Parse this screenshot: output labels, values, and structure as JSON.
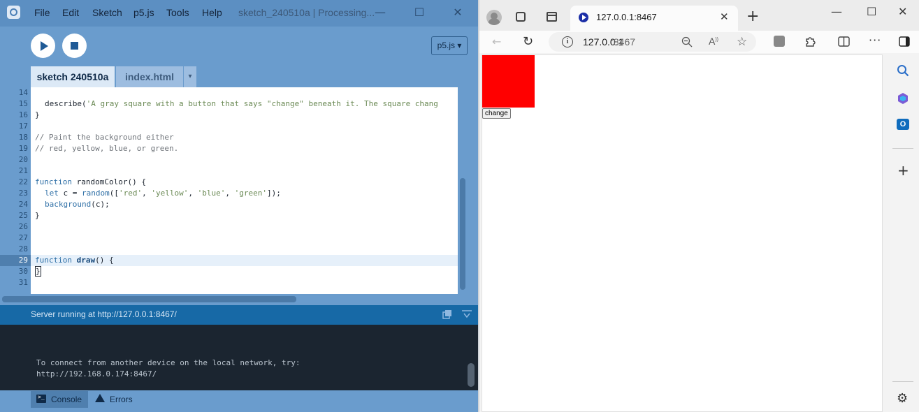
{
  "ide": {
    "menu": [
      "File",
      "Edit",
      "Sketch",
      "p5.js",
      "Tools",
      "Help"
    ],
    "window_title": "sketch_240510a | Processing...",
    "mode": "p5.js ▾",
    "tabs": [
      {
        "label": "sketch 240510a",
        "active": true
      },
      {
        "label": "index.html",
        "active": false
      }
    ],
    "tab_menu_arrow": "▾",
    "line_numbers": [
      "14",
      "15",
      "16",
      "17",
      "18",
      "19",
      "20",
      "21",
      "22",
      "23",
      "24",
      "25",
      "26",
      "27",
      "28",
      "29",
      "30",
      "31"
    ],
    "current_line": "29",
    "code": {
      "l15": "describe(",
      "l15_str": "'A gray square with a button that says \"change\" beneath it. The square chang",
      "l16": "}",
      "l18": "// Paint the background either",
      "l19": "// red, yellow, blue, or green.",
      "l22_kw": "function",
      "l22_rest": " randomColor() {",
      "l23_kw": "let",
      "l23_a": " c = ",
      "l23_fn": "random",
      "l23_b": "([",
      "l23_s1": "'red'",
      "l23_s2": "'yellow'",
      "l23_s3": "'blue'",
      "l23_s4": "'green'",
      "l23_c": "]);",
      "l24_fn": "background",
      "l24_rest": "(c);",
      "l25": "}",
      "l29_kw": "function",
      "l29_fn": "draw",
      "l29_rest": "() {",
      "l30": "}"
    },
    "status": "Server running at http://127.0.0.1:8467/",
    "console_lines": [
      "To connect from another device on the local network, try:",
      "http://192.168.0.174:8467/"
    ],
    "bottom_tabs": {
      "console": "Console",
      "errors": "Errors"
    }
  },
  "browser": {
    "tab_title": "127.0.0.1:8467",
    "url_host": "127.0.0.1",
    "url_port": ":8467",
    "page": {
      "canvas_color": "#ff0000",
      "button_label": "change"
    }
  }
}
